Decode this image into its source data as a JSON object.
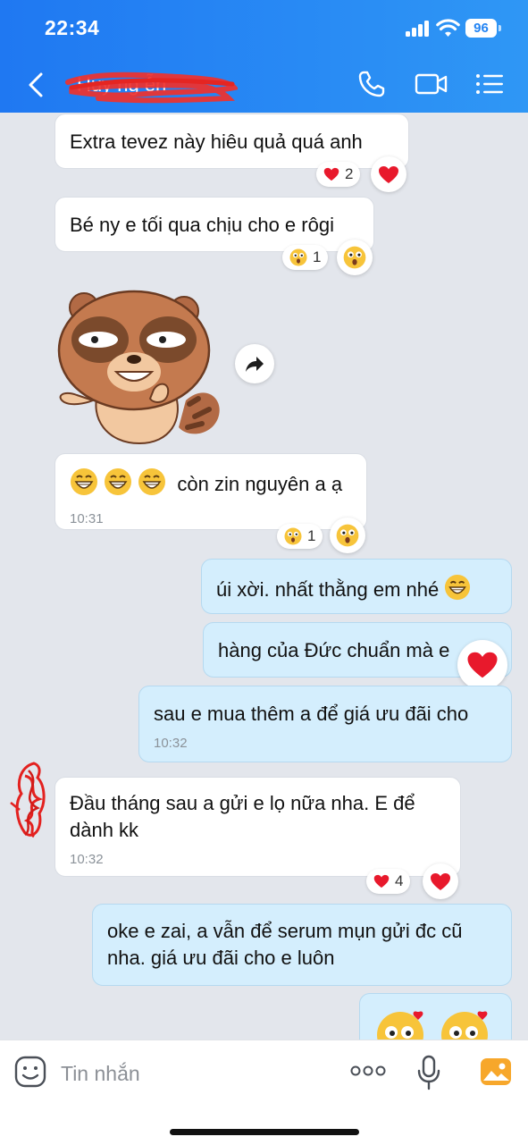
{
  "status_bar": {
    "time": "22:34",
    "battery": "96"
  },
  "header": {
    "contact_name": "Huy ng  ễn"
  },
  "messages": [
    {
      "text": "Extra tevez này hiêu quả quá anh",
      "reaction_count": "2"
    },
    {
      "text": "Bé ny e tối qua chịu cho e rôgi",
      "reaction_count": "1"
    },
    {
      "text": "còn zin nguyên a ạ",
      "time": "10:31",
      "reaction_count": "1"
    },
    {
      "text": "úi xời. nhất thằng em nhé"
    },
    {
      "text": "hàng của Đức chuẩn mà e"
    },
    {
      "text": "sau e mua thêm a để giá ưu đãi cho",
      "time": "10:32"
    },
    {
      "text_line1": "Đầu tháng sau a gửi e lọ nữa nha. E để",
      "text_line2": "dành kk",
      "time": "10:32",
      "reaction_count": "4"
    },
    {
      "text_line1": "oke e zai, a vẫn để serum mụn gửi đc cũ",
      "text_line2": "nha. giá ưu đãi cho e luôn"
    }
  ],
  "input": {
    "placeholder": "Tin nhắn"
  },
  "colors": {
    "header_start": "#1f78f2",
    "header_end": "#2f97f5",
    "outgoing_bubble": "#d4eefd",
    "incoming_bubble": "#ffffff",
    "heart": "#e8192c"
  },
  "icons": [
    "back-icon",
    "phone-icon",
    "video-call-icon",
    "menu-list-icon",
    "forward-icon",
    "heart-icon",
    "surprised-emoji-icon",
    "grin-emoji-icon",
    "sticker-icon",
    "more-icon",
    "mic-icon",
    "image-icon"
  ]
}
